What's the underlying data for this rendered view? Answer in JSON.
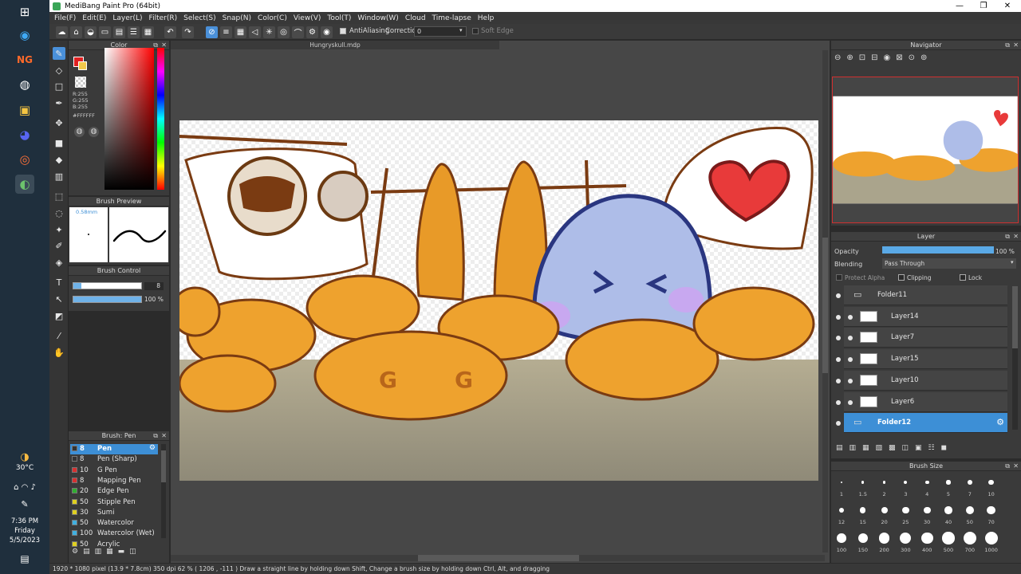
{
  "window": {
    "title": "MediBang Paint Pro (64bit)",
    "minimize": "—",
    "restore": "❐",
    "close": "✕"
  },
  "menu": [
    "File(F)",
    "Edit(E)",
    "Layer(L)",
    "Filter(R)",
    "Select(S)",
    "Snap(N)",
    "Color(C)",
    "View(V)",
    "Tool(T)",
    "Window(W)",
    "Cloud",
    "Time-lapse",
    "Help"
  ],
  "toolbar": {
    "antialiasing_label": "AntiAliasing",
    "correction_label": "Correction",
    "correction_value": "0",
    "soft_edge_label": "Soft Edge"
  },
  "color_panel": {
    "title": "Color",
    "r": "R:255",
    "g": "G:255",
    "b": "B:255",
    "hex": "#FFFFFF",
    "primary_color": "#e02020",
    "secondary_color": "#f2c84b"
  },
  "brush_preview": {
    "title": "Brush Preview",
    "size": "0.58mm"
  },
  "brush_control": {
    "title": "Brush Control",
    "size_value": "8",
    "opacity_value": "100 %",
    "opacity_fraction": 1.0
  },
  "brush_list": {
    "title": "Brush: Pen",
    "items": [
      {
        "num": "8",
        "name": "Pen",
        "color": "#333333",
        "selected": true
      },
      {
        "num": "8",
        "name": "Pen (Sharp)",
        "color": "#333333"
      },
      {
        "num": "10",
        "name": "G Pen",
        "color": "#d83030"
      },
      {
        "num": "8",
        "name": "Mapping Pen",
        "color": "#d83030"
      },
      {
        "num": "20",
        "name": "Edge Pen",
        "color": "#30b030"
      },
      {
        "num": "50",
        "name": "Stipple Pen",
        "color": "#e0d020"
      },
      {
        "num": "30",
        "name": "Sumi",
        "color": "#e0d020"
      },
      {
        "num": "50",
        "name": "Watercolor",
        "color": "#40b0e0"
      },
      {
        "num": "100",
        "name": "Watercolor (Wet)",
        "color": "#40b0e0"
      },
      {
        "num": "50",
        "name": "Acrylic",
        "color": "#e0d020"
      }
    ]
  },
  "canvas": {
    "doc_name": "Hungryskull.mdp"
  },
  "navigator": {
    "title": "Navigator"
  },
  "layer_panel": {
    "title": "Layer",
    "opacity_label": "Opacity",
    "opacity_value": "100 %",
    "opacity_fraction": 1.0,
    "blending_label": "Blending",
    "blending_value": "Pass Through",
    "protect_alpha": "Protect Alpha",
    "clipping": "Clipping",
    "lock": "Lock",
    "layers": [
      {
        "name": "Folder11",
        "type": "folder",
        "indent": 0
      },
      {
        "name": "Layer14",
        "type": "layer",
        "indent": 1
      },
      {
        "name": "Layer7",
        "type": "layer",
        "indent": 1
      },
      {
        "name": "Layer15",
        "type": "layer",
        "indent": 1
      },
      {
        "name": "Layer10",
        "type": "layer",
        "indent": 1
      },
      {
        "name": "Layer6",
        "type": "layer",
        "indent": 1
      },
      {
        "name": "Folder12",
        "type": "folder",
        "indent": 0,
        "selected": true
      }
    ]
  },
  "brush_size": {
    "title": "Brush Size",
    "sizes": [
      "1",
      "1.5",
      "2",
      "3",
      "4",
      "5",
      "7",
      "10",
      "12",
      "15",
      "20",
      "25",
      "30",
      "40",
      "50",
      "70",
      "100",
      "150",
      "200",
      "300",
      "400",
      "500",
      "700",
      "1000"
    ]
  },
  "status": {
    "text": "1920 * 1080 pixel   (13.9 * 7.8cm)   350 dpi   62 %   ( 1206 , -111 )   Draw a straight line by holding down Shift, Change a brush size by holding down Ctrl, Alt, and dragging"
  },
  "system": {
    "temperature": "30°C",
    "time": "7:36 PM",
    "day": "Friday",
    "date": "5/5/2023"
  }
}
